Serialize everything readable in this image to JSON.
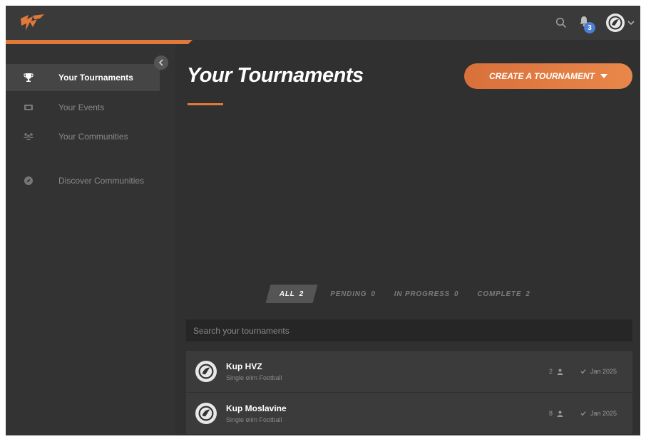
{
  "colors": {
    "accent": "#e0793a",
    "background": "#303030",
    "sidebar": "#333333",
    "badge": "#4a7fd4"
  },
  "header": {
    "notification_count": "3"
  },
  "sidebar": {
    "items": [
      {
        "label": "Your Tournaments",
        "icon": "trophy-icon",
        "active": true
      },
      {
        "label": "Your Events",
        "icon": "ticket-icon",
        "active": false
      },
      {
        "label": "Your Communities",
        "icon": "people-icon",
        "active": false
      },
      {
        "label": "Discover Communities",
        "icon": "compass-icon",
        "active": false
      }
    ]
  },
  "main": {
    "title": "Your Tournaments",
    "create_button": "CREATE A TOURNAMENT",
    "filters": [
      {
        "label": "ALL",
        "count": "2",
        "active": true
      },
      {
        "label": "PENDING",
        "count": "0",
        "active": false
      },
      {
        "label": "IN PROGRESS",
        "count": "0",
        "active": false
      },
      {
        "label": "COMPLETE",
        "count": "2",
        "active": false
      }
    ],
    "search_placeholder": "Search your tournaments",
    "tournaments": [
      {
        "name": "Kup HVZ",
        "subtitle": "Single elim Football",
        "participants": "2",
        "date": "Jan 2025"
      },
      {
        "name": "Kup Moslavine",
        "subtitle": "Single elim Football",
        "participants": "8",
        "date": "Jan 2025"
      }
    ]
  }
}
